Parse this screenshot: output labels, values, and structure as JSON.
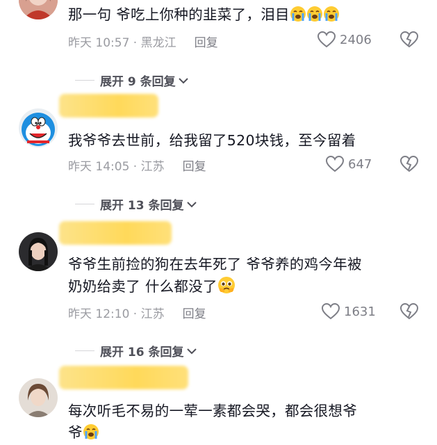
{
  "comments": [
    {
      "text_lines": [
        "那一句 爷吃上你种的韭菜了，泪目"
      ],
      "trailing_emoji": "crying",
      "trailing_emoji_count": 3,
      "meta": "昨天 10:57 · 黑龙江",
      "reply_label": "回复",
      "likes": "2406"
    },
    {
      "text_lines": [
        "我爷爷去世前，给我留了520块钱，至今留着"
      ],
      "meta": "昨天 14:05 · 江苏",
      "reply_label": "回复",
      "likes": "647"
    },
    {
      "text_lines": [
        "爷爷生前捡的狗在去年死了 爷爷养的鸡今年被",
        "奶奶给卖了 什么都没了"
      ],
      "trailing_emoji": "pleading",
      "meta": "昨天 12:10 · 江苏",
      "reply_label": "回复",
      "likes": "1631"
    },
    {
      "text_lines": [
        "每次听毛不易的一荤一素都会哭，都会很想爷",
        "爷"
      ],
      "trailing_emoji": "crying"
    }
  ],
  "expanders": [
    {
      "label": "展开 9 条回复"
    },
    {
      "label": "展开 13 条回复"
    },
    {
      "label": "展开 16 条回复"
    }
  ],
  "colors": {
    "text": "#161823",
    "meta": "#9a9ba1",
    "name_redaction": "#ffd95a",
    "emoji_face": "#ffcc33",
    "emoji_tear": "#4aa3ff"
  }
}
